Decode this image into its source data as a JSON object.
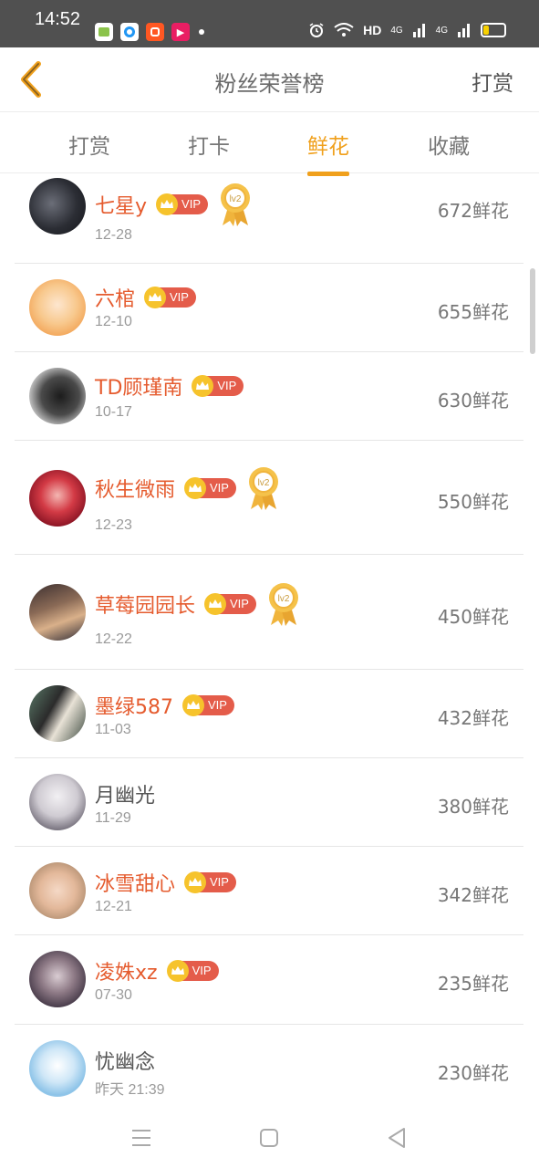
{
  "status_bar": {
    "time": "14:52",
    "net_label": "HD",
    "signal1": "4G",
    "signal2": "4G",
    "icons": [
      "app-icon-1",
      "app-icon-2",
      "app-icon-3",
      "app-icon-4",
      "alarm-icon",
      "wifi-icon",
      "signal-icon",
      "battery-icon"
    ]
  },
  "nav": {
    "title": "粉丝荣誉榜",
    "action": "打赏",
    "back_icon": "chevron-left-icon"
  },
  "tabs": [
    {
      "label": "打赏",
      "active": false
    },
    {
      "label": "打卡",
      "active": false
    },
    {
      "label": "鲜花",
      "active": true
    },
    {
      "label": "收藏",
      "active": false
    }
  ],
  "colors": {
    "accent": "#f0a01c",
    "name_vip": "#e55b2e",
    "vip_badge": "#e45c4a",
    "crown": "#f6c32c"
  },
  "vip_label": "VIP",
  "medal_label": "lv2",
  "fans": [
    {
      "name": "七星y",
      "date": "12-28",
      "count": "672鲜花",
      "vip": true,
      "medal": true
    },
    {
      "name": "六棺",
      "date": "12-10",
      "count": "655鲜花",
      "vip": true,
      "medal": false
    },
    {
      "name": "TD顾瑾南",
      "date": "10-17",
      "count": "630鲜花",
      "vip": true,
      "medal": false
    },
    {
      "name": "秋生微雨",
      "date": "12-23",
      "count": "550鲜花",
      "vip": true,
      "medal": true
    },
    {
      "name": "草莓园园长",
      "date": "12-22",
      "count": "450鲜花",
      "vip": true,
      "medal": true
    },
    {
      "name": "墨绿587",
      "date": "11-03",
      "count": "432鲜花",
      "vip": true,
      "medal": false
    },
    {
      "name": "月幽光",
      "date": "11-29",
      "count": "380鲜花",
      "vip": false,
      "medal": false
    },
    {
      "name": "冰雪甜心",
      "date": "12-21",
      "count": "342鲜花",
      "vip": true,
      "medal": false
    },
    {
      "name": "凌姝xz",
      "date": "07-30",
      "count": "235鲜花",
      "vip": true,
      "medal": false
    },
    {
      "name": "忧幽念",
      "date": "昨天 21:39",
      "count": "230鲜花",
      "vip": false,
      "medal": false
    }
  ],
  "bottom_nav": [
    "menu-icon",
    "home-icon",
    "back-icon"
  ]
}
